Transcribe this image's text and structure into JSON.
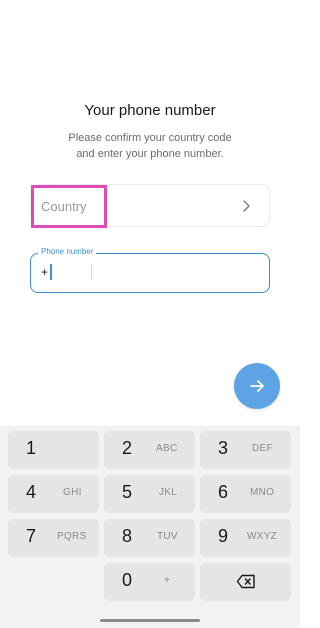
{
  "header": {
    "title": "Your phone number",
    "subtitle_line1": "Please confirm your country code",
    "subtitle_line2": "and enter your phone number."
  },
  "country": {
    "label": "Country",
    "chevron_icon": "chevron-right-icon"
  },
  "phone": {
    "legend": "Phone number",
    "code_value": "+",
    "number_value": ""
  },
  "fab": {
    "icon": "arrow-right-icon",
    "color": "#5ea3e3"
  },
  "keyboard": {
    "keys": [
      {
        "digit": "1",
        "letters": ""
      },
      {
        "digit": "2",
        "letters": "ABC"
      },
      {
        "digit": "3",
        "letters": "DEF"
      },
      {
        "digit": "4",
        "letters": "GHI"
      },
      {
        "digit": "5",
        "letters": "JKL"
      },
      {
        "digit": "6",
        "letters": "MNO"
      },
      {
        "digit": "7",
        "letters": "PQRS"
      },
      {
        "digit": "8",
        "letters": "TUV"
      },
      {
        "digit": "9",
        "letters": "WXYZ"
      },
      {
        "digit": "0",
        "letters": "+"
      }
    ],
    "backspace_icon": "backspace-icon"
  },
  "colors": {
    "accent": "#3f8fd6",
    "highlight": "#e04cb6"
  }
}
